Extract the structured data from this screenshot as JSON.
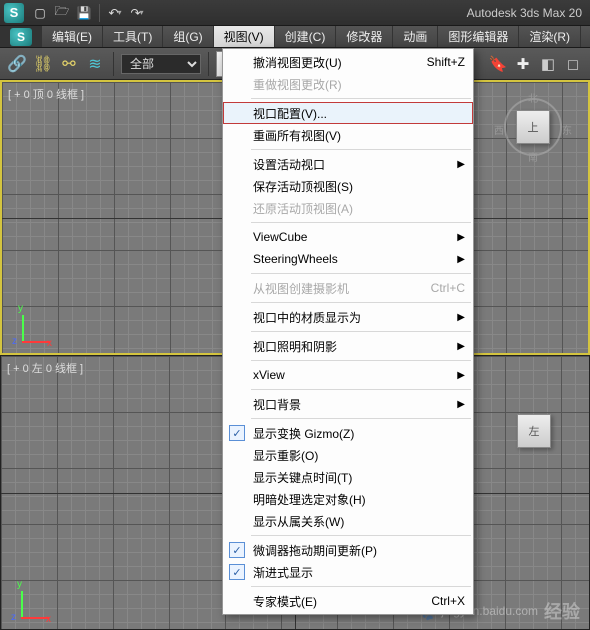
{
  "titlebar": {
    "app_title": "Autodesk 3ds Max  20"
  },
  "menubar": {
    "items": [
      {
        "label": "编辑(E)"
      },
      {
        "label": "工具(T)"
      },
      {
        "label": "组(G)"
      },
      {
        "label": "视图(V)",
        "active": true
      },
      {
        "label": "创建(C)"
      },
      {
        "label": "修改器"
      },
      {
        "label": "动画"
      },
      {
        "label": "图形编辑器"
      },
      {
        "label": "渲染(R)"
      }
    ]
  },
  "toolbar": {
    "filter_label": "全部",
    "right_icons": {
      "bookmark": "bookmark-icon",
      "plus": "plus-icon",
      "cube": "cube-icon",
      "square": "square-icon"
    }
  },
  "viewports": {
    "top_left": {
      "label": "[ + 0  顶 0 线框 ]",
      "viewcube": "上"
    },
    "bottom_left": {
      "label": "[ + 0  左 0 线框 ]",
      "viewcube": "左"
    }
  },
  "dropdown": {
    "items": [
      {
        "label": "撤消视图更改(U)",
        "shortcut": "Shift+Z"
      },
      {
        "label": "重做视图更改(R)",
        "disabled": true
      },
      {
        "sep": true
      },
      {
        "label": "视口配置(V)...",
        "highlight": true
      },
      {
        "label": "重画所有视图(V)"
      },
      {
        "sep": true
      },
      {
        "label": "设置活动视口",
        "submenu": true
      },
      {
        "label": "保存活动顶视图(S)"
      },
      {
        "label": "还原活动顶视图(A)",
        "disabled": true
      },
      {
        "sep": true
      },
      {
        "label": "ViewCube",
        "submenu": true
      },
      {
        "label": "SteeringWheels",
        "submenu": true
      },
      {
        "sep": true
      },
      {
        "label": "从视图创建摄影机",
        "shortcut": "Ctrl+C",
        "disabled": true
      },
      {
        "sep": true
      },
      {
        "label": "视口中的材质显示为",
        "submenu": true
      },
      {
        "sep": true
      },
      {
        "label": "视口照明和阴影",
        "submenu": true
      },
      {
        "sep": true
      },
      {
        "label": "xView",
        "submenu": true
      },
      {
        "sep": true
      },
      {
        "label": "视口背景",
        "submenu": true
      },
      {
        "sep": true
      },
      {
        "label": "显示变换 Gizmo(Z)",
        "checked": true
      },
      {
        "label": "显示重影(O)"
      },
      {
        "label": "显示关键点时间(T)"
      },
      {
        "label": "明暗处理选定对象(H)"
      },
      {
        "label": "显示从属关系(W)"
      },
      {
        "sep": true
      },
      {
        "label": "微调器拖动期间更新(P)",
        "checked": true
      },
      {
        "label": "渐进式显示",
        "checked": true
      },
      {
        "sep": true
      },
      {
        "label": "专家模式(E)",
        "shortcut": "Ctrl+X"
      }
    ]
  },
  "watermark": {
    "text": "jingyan.baidu.com",
    "brand": "经验"
  },
  "viewcube_dirs": {
    "n": "北",
    "s": "南",
    "e": "东",
    "w": "西"
  }
}
